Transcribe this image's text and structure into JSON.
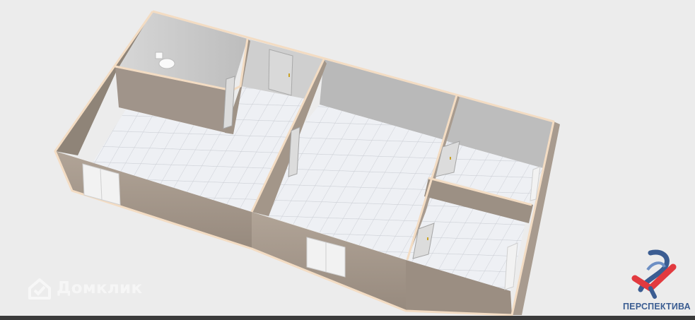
{
  "watermark": {
    "text": "Домклик",
    "icon": "house-check-icon"
  },
  "brand": {
    "name": "ПЕРСПЕКТИВА",
    "logo": "perspektiva-logo-icon"
  },
  "colors": {
    "background": "#ececec",
    "wall_face": "#a3968a",
    "wall_top": "#f3dcc3",
    "inner_wall": "#c9c9c9",
    "floor": "#eef0f4",
    "floor_grid": "#c9ccd3",
    "brand_blue": "#3b5d92",
    "brand_red": "#e23a3f"
  }
}
